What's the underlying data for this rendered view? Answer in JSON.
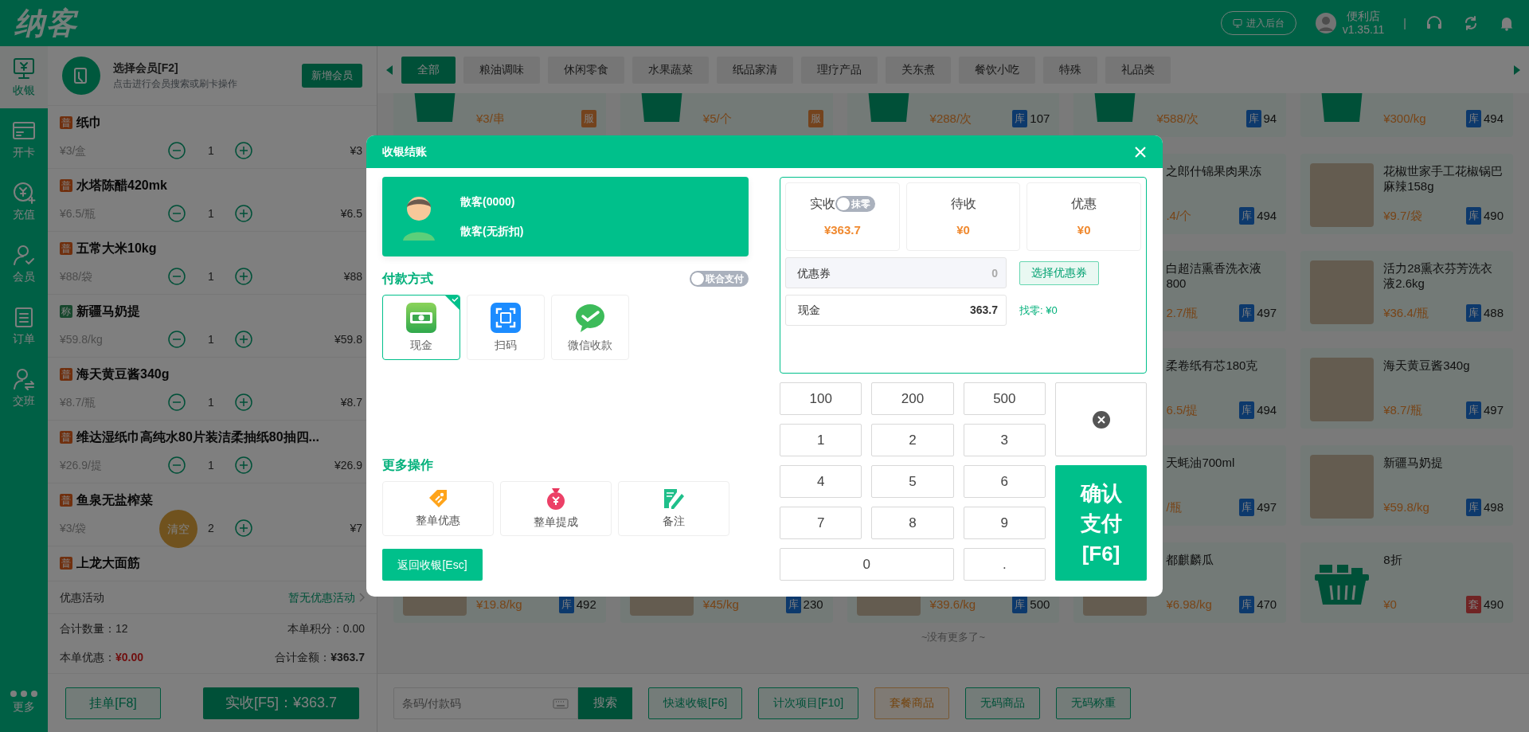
{
  "header": {
    "logo": "纳客",
    "backend_button": "进入后台",
    "store_name": "便利店",
    "version": "v1.35.11",
    "separator": "|"
  },
  "nav": [
    {
      "label": "收银",
      "kind": "register",
      "selected": true
    },
    {
      "label": "开卡",
      "kind": "card",
      "selected": false
    },
    {
      "label": "充值",
      "kind": "recharge",
      "selected": false
    },
    {
      "label": "会员",
      "kind": "member",
      "selected": false
    },
    {
      "label": "订单",
      "kind": "order",
      "selected": false
    },
    {
      "label": "交班",
      "kind": "shift",
      "selected": false
    }
  ],
  "nav_more": "更多",
  "member": {
    "title": "选择会员[F2]",
    "hint": "点击进行会员搜索或刷卡操作",
    "add_button": "新增会员"
  },
  "cart": [
    {
      "tag": "普",
      "kind": "regular",
      "name": "纸巾",
      "unit_price": "¥3/盒",
      "qty": "1",
      "subtotal": "¥3"
    },
    {
      "tag": "普",
      "kind": "regular",
      "name": "水塔陈醋420mk",
      "unit_price": "¥6.5/瓶",
      "qty": "1",
      "subtotal": "¥6.5"
    },
    {
      "tag": "普",
      "kind": "regular",
      "name": "五常大米10kg",
      "unit_price": "¥88/袋",
      "qty": "1",
      "subtotal": "¥88"
    },
    {
      "tag": "称",
      "kind": "weighed",
      "name": "新疆马奶提",
      "unit_price": "¥59.8/kg",
      "qty": "1",
      "subtotal": "¥59.8"
    },
    {
      "tag": "普",
      "kind": "regular",
      "name": "海天黄豆酱340g",
      "unit_price": "¥8.7/瓶",
      "qty": "1",
      "subtotal": "¥8.7"
    },
    {
      "tag": "普",
      "kind": "regular",
      "name": "维达湿纸巾高纯水80片装洁柔抽纸80抽四...",
      "unit_price": "¥26.9/提",
      "qty": "1",
      "subtotal": "¥26.9"
    },
    {
      "tag": "普",
      "kind": "regular",
      "name": "鱼泉无盐榨菜",
      "unit_price": "¥3/袋",
      "qty": "2",
      "subtotal": "¥7"
    },
    {
      "tag": "普",
      "kind": "regular",
      "name": "上龙大面筋"
    }
  ],
  "clear_button": "清空",
  "promo": {
    "label": "优惠活动",
    "value": "暂无优惠活动"
  },
  "totals": [
    {
      "label": "合计数量：",
      "value": "12",
      "kind": "plain"
    },
    {
      "label": "本单积分：",
      "value": "0.00",
      "kind": "plain"
    },
    {
      "label": "本单优惠：",
      "value": "¥0.00",
      "kind": "red"
    },
    {
      "label": "合计金额：",
      "value": "¥363.7",
      "kind": "bold"
    }
  ],
  "cart_buttons": {
    "hold": "挂单[F8]",
    "pay": "实收[F5]：¥363.7"
  },
  "categories": [
    {
      "label": "全部",
      "selected": true
    },
    {
      "label": "粮油调味",
      "selected": false
    },
    {
      "label": "休闲零食",
      "selected": false
    },
    {
      "label": "水果蔬菜",
      "selected": false
    },
    {
      "label": "纸品家清",
      "selected": false
    },
    {
      "label": "理疗产品",
      "selected": false
    },
    {
      "label": "关东煮",
      "selected": false
    },
    {
      "label": "餐饮小吃",
      "selected": false
    },
    {
      "label": "特殊",
      "selected": false
    },
    {
      "label": "礼品类",
      "selected": false
    }
  ],
  "products": [
    [
      {
        "kind": "bag",
        "price": "¥3/串",
        "tag": {
          "label": "服",
          "kind": "service"
        }
      },
      {
        "kind": "bag",
        "price": "¥5/个",
        "tag": {
          "label": "服",
          "kind": "service"
        }
      },
      {
        "kind": "bag",
        "price": "¥288/次",
        "tag": {
          "label": "库",
          "kind": "stock"
        },
        "stock": "107"
      },
      {
        "kind": "bag",
        "price": "¥588/次",
        "tag": {
          "label": "库",
          "kind": "stock"
        },
        "stock": "94"
      },
      {
        "kind": "bag",
        "price": "¥300/kg",
        "tag": {
          "label": "库",
          "kind": "stock"
        },
        "stock": "494"
      }
    ],
    [
      {
        "name": "之郎什锦果肉果冻",
        "price": ".4/个",
        "tag": {
          "label": "库",
          "kind": "stock"
        },
        "stock": "494"
      },
      {
        "kind": "photo",
        "name": "花椒世家手工花椒锅巴麻辣158g",
        "price": "¥9.7/袋",
        "tag": {
          "label": "库",
          "kind": "stock"
        },
        "stock": "490"
      }
    ],
    [
      {
        "name": "白超洁熏香洗衣液800",
        "price": "2.7/瓶",
        "tag": {
          "label": "库",
          "kind": "stock"
        },
        "stock": "497"
      },
      {
        "kind": "photo",
        "name": "活力28熏衣芬芳洗衣液2.6kg",
        "price": "¥36.4/瓶",
        "tag": {
          "label": "库",
          "kind": "stock"
        },
        "stock": "488"
      }
    ],
    [
      {
        "name": "柔卷纸有芯180克",
        "price": "6.5/提",
        "tag": {
          "label": "库",
          "kind": "stock"
        },
        "stock": "494"
      },
      {
        "kind": "photo",
        "name": "海天黄豆酱340g",
        "price": "¥8.7/瓶",
        "tag": {
          "label": "库",
          "kind": "stock"
        },
        "stock": "497"
      }
    ],
    [
      {
        "name": "天蚝油700ml",
        "price": "/瓶",
        "tag": {
          "label": "库",
          "kind": "stock"
        },
        "stock": "497"
      },
      {
        "kind": "photo",
        "name": "新疆马奶提",
        "price": "¥59.8/kg",
        "tag": {
          "label": "库",
          "kind": "stock"
        },
        "stock": "498"
      }
    ],
    [
      {
        "kind": "photo",
        "price": "¥19.8/kg",
        "tag": {
          "label": "库",
          "kind": "stock"
        },
        "stock": "492"
      },
      {
        "kind": "photo",
        "price": "¥45/kg",
        "tag": {
          "label": "库",
          "kind": "stock"
        },
        "stock": "230"
      },
      {
        "kind": "photo",
        "price": "¥39.6/kg",
        "tag": {
          "label": "库",
          "kind": "stock"
        },
        "stock": "500"
      },
      {
        "kind": "photo",
        "name": "都麒麟瓜",
        "price": "¥6.98/kg",
        "tag": {
          "label": "库",
          "kind": "stock"
        },
        "stock": "470"
      },
      {
        "kind": "basket",
        "name": "8折",
        "price": "¥0",
        "tag": {
          "label": "套",
          "kind": "package"
        },
        "stock": "490"
      }
    ]
  ],
  "end_note": "~没有更多了~",
  "bottom_bar": {
    "search_placeholder": "条码/付款码",
    "search_button": "搜索",
    "actions": [
      {
        "label": "快速收银[F6]",
        "kind": "green"
      },
      {
        "label": "计次项目[F10]",
        "kind": "green"
      },
      {
        "label": "套餐商品",
        "kind": "orange"
      },
      {
        "label": "无码商品",
        "kind": "green"
      },
      {
        "label": "无码称重",
        "kind": "green"
      }
    ]
  },
  "checkout": {
    "title": "收银结账",
    "customer": {
      "name": "散客(0000)",
      "level": "散客(无折扣)"
    },
    "payment_title": "付款方式",
    "combined_toggle": {
      "label": "联合支付",
      "on": false
    },
    "methods": [
      {
        "label": "现金",
        "kind": "cash",
        "selected": true
      },
      {
        "label": "扫码",
        "kind": "scan",
        "selected": false
      },
      {
        "label": "微信收款",
        "kind": "wechat",
        "selected": false
      }
    ],
    "more_title": "更多操作",
    "more_actions": [
      {
        "label": "整单优惠",
        "kind": "tag"
      },
      {
        "label": "整单提成",
        "kind": "moneybag"
      },
      {
        "label": "备注",
        "kind": "note"
      }
    ],
    "back_button": "返回收银[Esc]",
    "stats": [
      {
        "label": "实收",
        "value": "¥363.7",
        "toggle": {
          "label": "抹零",
          "on": false
        }
      },
      {
        "label": "待收",
        "value": "¥0"
      },
      {
        "label": "优惠",
        "value": "¥0"
      }
    ],
    "coupon": {
      "label": "优惠券",
      "placeholder": "0",
      "button": "选择优惠券"
    },
    "cash": {
      "label": "现金",
      "value": "363.7",
      "change": "找零: ¥0"
    },
    "keys": [
      [
        "100",
        "200",
        "500"
      ],
      [
        "1",
        "2",
        "3"
      ],
      [
        "4",
        "5",
        "6"
      ],
      [
        "7",
        "8",
        "9"
      ],
      [
        "0",
        "."
      ]
    ],
    "confirm_button": "确认支付[F6]"
  }
}
